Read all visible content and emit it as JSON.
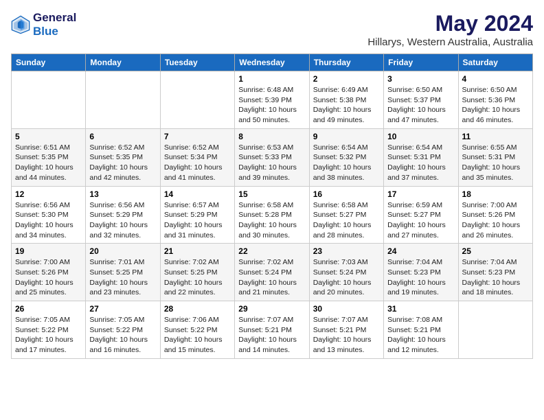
{
  "header": {
    "logo_line1": "General",
    "logo_line2": "Blue",
    "month": "May 2024",
    "location": "Hillarys, Western Australia, Australia"
  },
  "weekdays": [
    "Sunday",
    "Monday",
    "Tuesday",
    "Wednesday",
    "Thursday",
    "Friday",
    "Saturday"
  ],
  "weeks": [
    [
      {
        "day": "",
        "info": ""
      },
      {
        "day": "",
        "info": ""
      },
      {
        "day": "",
        "info": ""
      },
      {
        "day": "1",
        "info": "Sunrise: 6:48 AM\nSunset: 5:39 PM\nDaylight: 10 hours\nand 50 minutes."
      },
      {
        "day": "2",
        "info": "Sunrise: 6:49 AM\nSunset: 5:38 PM\nDaylight: 10 hours\nand 49 minutes."
      },
      {
        "day": "3",
        "info": "Sunrise: 6:50 AM\nSunset: 5:37 PM\nDaylight: 10 hours\nand 47 minutes."
      },
      {
        "day": "4",
        "info": "Sunrise: 6:50 AM\nSunset: 5:36 PM\nDaylight: 10 hours\nand 46 minutes."
      }
    ],
    [
      {
        "day": "5",
        "info": "Sunrise: 6:51 AM\nSunset: 5:35 PM\nDaylight: 10 hours\nand 44 minutes."
      },
      {
        "day": "6",
        "info": "Sunrise: 6:52 AM\nSunset: 5:35 PM\nDaylight: 10 hours\nand 42 minutes."
      },
      {
        "day": "7",
        "info": "Sunrise: 6:52 AM\nSunset: 5:34 PM\nDaylight: 10 hours\nand 41 minutes."
      },
      {
        "day": "8",
        "info": "Sunrise: 6:53 AM\nSunset: 5:33 PM\nDaylight: 10 hours\nand 39 minutes."
      },
      {
        "day": "9",
        "info": "Sunrise: 6:54 AM\nSunset: 5:32 PM\nDaylight: 10 hours\nand 38 minutes."
      },
      {
        "day": "10",
        "info": "Sunrise: 6:54 AM\nSunset: 5:31 PM\nDaylight: 10 hours\nand 37 minutes."
      },
      {
        "day": "11",
        "info": "Sunrise: 6:55 AM\nSunset: 5:31 PM\nDaylight: 10 hours\nand 35 minutes."
      }
    ],
    [
      {
        "day": "12",
        "info": "Sunrise: 6:56 AM\nSunset: 5:30 PM\nDaylight: 10 hours\nand 34 minutes."
      },
      {
        "day": "13",
        "info": "Sunrise: 6:56 AM\nSunset: 5:29 PM\nDaylight: 10 hours\nand 32 minutes."
      },
      {
        "day": "14",
        "info": "Sunrise: 6:57 AM\nSunset: 5:29 PM\nDaylight: 10 hours\nand 31 minutes."
      },
      {
        "day": "15",
        "info": "Sunrise: 6:58 AM\nSunset: 5:28 PM\nDaylight: 10 hours\nand 30 minutes."
      },
      {
        "day": "16",
        "info": "Sunrise: 6:58 AM\nSunset: 5:27 PM\nDaylight: 10 hours\nand 28 minutes."
      },
      {
        "day": "17",
        "info": "Sunrise: 6:59 AM\nSunset: 5:27 PM\nDaylight: 10 hours\nand 27 minutes."
      },
      {
        "day": "18",
        "info": "Sunrise: 7:00 AM\nSunset: 5:26 PM\nDaylight: 10 hours\nand 26 minutes."
      }
    ],
    [
      {
        "day": "19",
        "info": "Sunrise: 7:00 AM\nSunset: 5:26 PM\nDaylight: 10 hours\nand 25 minutes."
      },
      {
        "day": "20",
        "info": "Sunrise: 7:01 AM\nSunset: 5:25 PM\nDaylight: 10 hours\nand 23 minutes."
      },
      {
        "day": "21",
        "info": "Sunrise: 7:02 AM\nSunset: 5:25 PM\nDaylight: 10 hours\nand 22 minutes."
      },
      {
        "day": "22",
        "info": "Sunrise: 7:02 AM\nSunset: 5:24 PM\nDaylight: 10 hours\nand 21 minutes."
      },
      {
        "day": "23",
        "info": "Sunrise: 7:03 AM\nSunset: 5:24 PM\nDaylight: 10 hours\nand 20 minutes."
      },
      {
        "day": "24",
        "info": "Sunrise: 7:04 AM\nSunset: 5:23 PM\nDaylight: 10 hours\nand 19 minutes."
      },
      {
        "day": "25",
        "info": "Sunrise: 7:04 AM\nSunset: 5:23 PM\nDaylight: 10 hours\nand 18 minutes."
      }
    ],
    [
      {
        "day": "26",
        "info": "Sunrise: 7:05 AM\nSunset: 5:22 PM\nDaylight: 10 hours\nand 17 minutes."
      },
      {
        "day": "27",
        "info": "Sunrise: 7:05 AM\nSunset: 5:22 PM\nDaylight: 10 hours\nand 16 minutes."
      },
      {
        "day": "28",
        "info": "Sunrise: 7:06 AM\nSunset: 5:22 PM\nDaylight: 10 hours\nand 15 minutes."
      },
      {
        "day": "29",
        "info": "Sunrise: 7:07 AM\nSunset: 5:21 PM\nDaylight: 10 hours\nand 14 minutes."
      },
      {
        "day": "30",
        "info": "Sunrise: 7:07 AM\nSunset: 5:21 PM\nDaylight: 10 hours\nand 13 minutes."
      },
      {
        "day": "31",
        "info": "Sunrise: 7:08 AM\nSunset: 5:21 PM\nDaylight: 10 hours\nand 12 minutes."
      },
      {
        "day": "",
        "info": ""
      }
    ]
  ]
}
